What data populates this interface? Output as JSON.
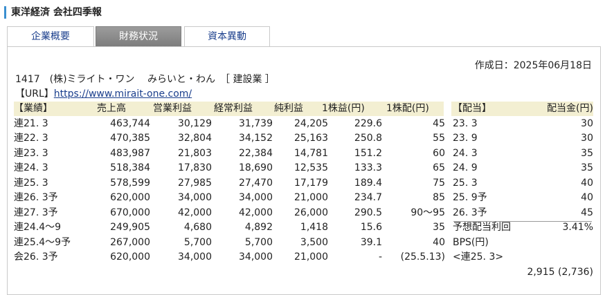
{
  "title": "東洋経済 会社四季報",
  "tabs": [
    {
      "label": "企業概要",
      "active": false
    },
    {
      "label": "財務状況",
      "active": true
    },
    {
      "label": "資本異動",
      "active": false
    }
  ],
  "created": "作成日：2025年06月18日",
  "company_line": "1417　(株)ミライト・ワン　 みらいと・わん　［ 建設業 ］",
  "url_label": "【URL】",
  "url": "https://www.mirait-one.com/",
  "performance": {
    "headers": [
      "【業績】",
      "売上高",
      "営業利益",
      "経常利益",
      "純利益",
      "1株益(円)",
      "1株配(円)"
    ],
    "rows": [
      [
        "連21. 3",
        "463,744",
        "30,129",
        "31,739",
        "24,205",
        "229.6",
        "45"
      ],
      [
        "連22. 3",
        "470,385",
        "32,804",
        "34,152",
        "25,163",
        "250.8",
        "55"
      ],
      [
        "連23. 3",
        "483,987",
        "21,803",
        "22,384",
        "14,781",
        "151.2",
        "60"
      ],
      [
        "連24. 3",
        "518,384",
        "17,830",
        "18,690",
        "12,535",
        "133.3",
        "65"
      ],
      [
        "連25. 3",
        "578,599",
        "27,985",
        "27,470",
        "17,179",
        "189.4",
        "75"
      ],
      [
        "連26. 3予",
        "620,000",
        "34,000",
        "34,000",
        "21,000",
        "234.7",
        "85"
      ],
      [
        "連27. 3予",
        "670,000",
        "42,000",
        "42,000",
        "26,000",
        "290.5",
        "90～95"
      ],
      [
        "連24.4～9",
        "249,905",
        "4,680",
        "4,892",
        "1,418",
        "15.6",
        "35"
      ],
      [
        "連25.4～9予",
        "267,000",
        "5,700",
        "5,700",
        "3,500",
        "39.1",
        "40"
      ],
      [
        "会26. 3予",
        "620,000",
        "34,000",
        "34,000",
        "21,000",
        "-",
        "(25.5.13)"
      ]
    ]
  },
  "dividend": {
    "headers": [
      "【配当】",
      "配当金(円)"
    ],
    "rows": [
      [
        "23. 3",
        "30"
      ],
      [
        "23. 9",
        "30"
      ],
      [
        "24. 3",
        "35"
      ],
      [
        "24. 9",
        "35"
      ],
      [
        "25. 3",
        "40"
      ],
      [
        "25. 9予",
        "40"
      ],
      [
        "26. 3予",
        "45"
      ]
    ],
    "yield_label": "予想配当利回",
    "yield_value": "3.41%",
    "bps_label": "BPS(円)",
    "bps_period": "<連25. 3>",
    "bps_value": "2,915 (2,736)"
  }
}
